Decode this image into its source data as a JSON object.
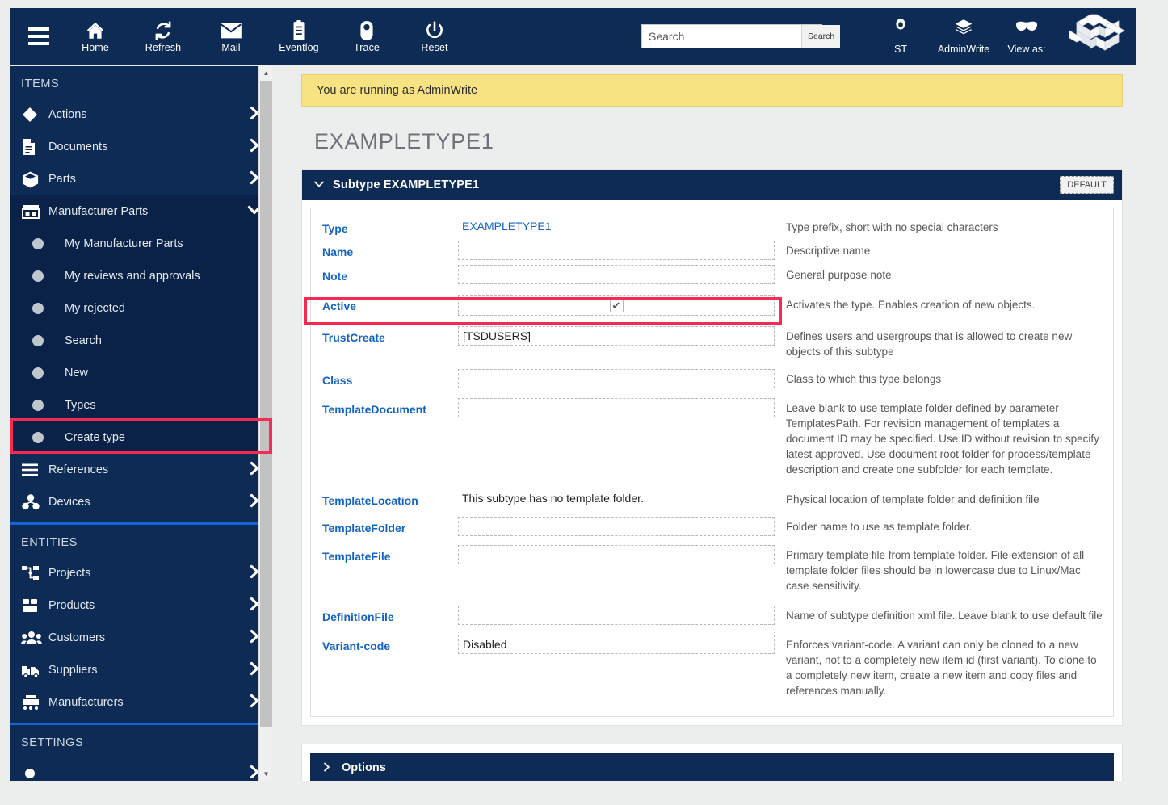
{
  "topbar": {
    "menu_icon": "hamburger-icon",
    "items": [
      {
        "label": "Home",
        "icon": "home-icon"
      },
      {
        "label": "Refresh",
        "icon": "refresh-icon"
      },
      {
        "label": "Mail",
        "icon": "mail-icon"
      },
      {
        "label": "Eventlog",
        "icon": "eventlog-icon"
      },
      {
        "label": "Trace",
        "icon": "trace-icon"
      },
      {
        "label": "Reset",
        "icon": "power-icon"
      }
    ],
    "search": {
      "value": "",
      "placeholder": "Search",
      "button_label": "Search"
    },
    "right_items": [
      {
        "label": "ST",
        "icon": "user-icon"
      },
      {
        "label": "AdminWrite",
        "icon": "layers-icon"
      },
      {
        "label": "View as:",
        "icon": "mask-icon"
      }
    ],
    "logo_name": "app-logo"
  },
  "sidebar": {
    "sections": [
      {
        "title": "ITEMS",
        "items": [
          {
            "label": "Actions",
            "icon": "diamond-icon",
            "chevron": "right",
            "type": "group"
          },
          {
            "label": "Documents",
            "icon": "document-icon",
            "chevron": "right",
            "type": "group"
          },
          {
            "label": "Parts",
            "icon": "box-icon",
            "chevron": "right",
            "type": "group"
          },
          {
            "label": "Manufacturer Parts",
            "icon": "factory-icon",
            "chevron": "down",
            "type": "group-expanded"
          },
          {
            "label": "My Manufacturer Parts",
            "icon": "bullet-icon",
            "type": "sub"
          },
          {
            "label": "My reviews and approvals",
            "icon": "bullet-icon",
            "type": "sub"
          },
          {
            "label": "My rejected",
            "icon": "bullet-icon",
            "type": "sub"
          },
          {
            "label": "Search",
            "icon": "bullet-icon",
            "type": "sub"
          },
          {
            "label": "New",
            "icon": "bullet-icon",
            "type": "sub"
          },
          {
            "label": "Types",
            "icon": "bullet-icon",
            "type": "sub"
          },
          {
            "label": "Create type",
            "icon": "bullet-icon",
            "type": "sub",
            "highlighted": true
          },
          {
            "label": "References",
            "icon": "list-icon",
            "chevron": "right",
            "type": "group"
          },
          {
            "label": "Devices",
            "icon": "devices-icon",
            "chevron": "right",
            "type": "group"
          }
        ]
      },
      {
        "title": "ENTITIES",
        "items": [
          {
            "label": "Projects",
            "icon": "project-tree-icon",
            "chevron": "right",
            "type": "group"
          },
          {
            "label": "Products",
            "icon": "products-icon",
            "chevron": "right",
            "type": "group"
          },
          {
            "label": "Customers",
            "icon": "customers-icon",
            "chevron": "right",
            "type": "group"
          },
          {
            "label": "Suppliers",
            "icon": "suppliers-truck-icon",
            "chevron": "right",
            "type": "group"
          },
          {
            "label": "Manufacturers",
            "icon": "manufacturers-icon",
            "chevron": "right",
            "type": "group"
          }
        ]
      },
      {
        "title": "SETTINGS",
        "items": []
      }
    ]
  },
  "main": {
    "banner": "You are running as AdminWrite",
    "page_title": "EXAMPLETYPE1",
    "card": {
      "caret": "chevron-down",
      "title": "Subtype EXAMPLETYPE1",
      "default_button": "DEFAULT",
      "fields": [
        {
          "label": "Type",
          "kind": "link",
          "value": "EXAMPLETYPE1",
          "description": "Type prefix, short with no special characters"
        },
        {
          "label": "Name",
          "kind": "input",
          "value": "",
          "description": "Descriptive name"
        },
        {
          "label": "Note",
          "kind": "input",
          "value": "",
          "description": "General purpose note"
        },
        {
          "label": "Active",
          "kind": "checkbox",
          "value": "checked",
          "description": "Activates the type. Enables creation of new objects.",
          "highlighted": true
        },
        {
          "label": "TrustCreate",
          "kind": "input",
          "value": "[TSDUSERS]",
          "description": "Defines users and usergroups that is allowed to create new objects of this subtype"
        },
        {
          "label": "Class",
          "kind": "input",
          "value": "",
          "description": "Class to which this type belongs"
        },
        {
          "label": "TemplateDocument",
          "kind": "input",
          "value": "",
          "description": "Leave blank to use template folder defined by parameter TemplatesPath. For revision management of templates a document ID may be specified. Use ID without revision to specify latest approved. Use document root folder for process/template description and create one subfolder for each template."
        },
        {
          "label": "TemplateLocation",
          "kind": "text",
          "value": "This subtype has no template folder.",
          "description": "Physical location of template folder and definition file"
        },
        {
          "label": "TemplateFolder",
          "kind": "input",
          "value": "",
          "description": "Folder name to use as template folder."
        },
        {
          "label": "TemplateFile",
          "kind": "input",
          "value": "",
          "description": "Primary template file from template folder. File extension of all template folder files should be in lowercase due to Linux/Mac case sensitivity."
        },
        {
          "label": "DefinitionFile",
          "kind": "input",
          "value": "",
          "description": "Name of subtype definition xml file. Leave blank to use default file"
        },
        {
          "label": "Variant-code",
          "kind": "input",
          "value": "Disabled",
          "description": "Enforces variant-code. A variant can only be cloned to a new variant, not to a completely new item id (first variant). To clone to a completely new item, create a new item and copy files and references manually."
        }
      ]
    },
    "options": {
      "caret": "chevron-right",
      "title": "Options"
    }
  },
  "colors": {
    "navy": "#0d2b55",
    "navy_dark": "#0a2247",
    "highlight_red": "#f72a52",
    "banner_yellow": "#f8e383",
    "label_blue": "#1565c0",
    "divider_blue": "#1364d4",
    "page_bg": "#eceded"
  }
}
